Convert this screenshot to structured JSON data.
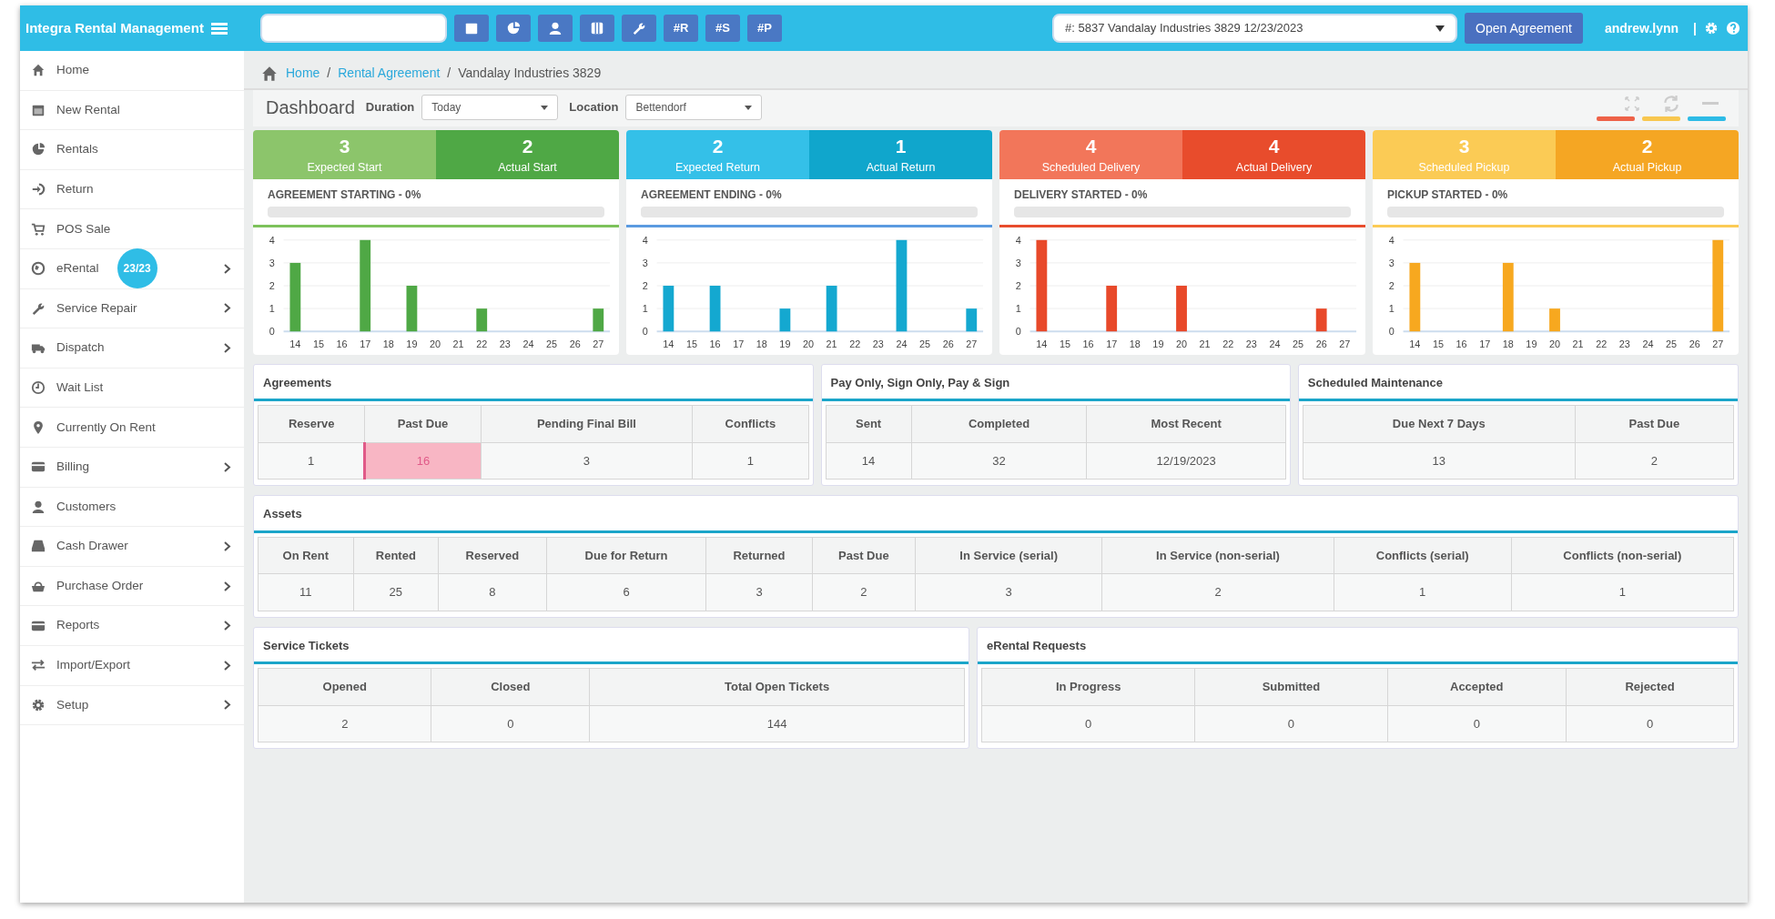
{
  "topbar": {
    "brand": "Integra Rental Management",
    "toolbar": [
      {
        "kind": "icon"
      },
      {
        "kind": "icon"
      },
      {
        "kind": "icon"
      },
      {
        "kind": "icon"
      },
      {
        "kind": "icon"
      },
      {
        "kind": "text",
        "label": "#R"
      },
      {
        "kind": "text",
        "label": "#S"
      },
      {
        "kind": "text",
        "label": "#P"
      }
    ],
    "agreement_select": {
      "value": "#: 5837 Vandalay Industries 3829 12/23/2023"
    },
    "open_button": "Open Agreement",
    "user": "andrew.lynn",
    "separator": "|"
  },
  "sidebar": {
    "items": [
      {
        "label": "Home",
        "submenu": false
      },
      {
        "label": "New Rental",
        "submenu": false
      },
      {
        "label": "Rentals",
        "submenu": false
      },
      {
        "label": "Return",
        "submenu": false
      },
      {
        "label": "POS Sale",
        "submenu": false
      },
      {
        "label": "eRental",
        "submenu": true,
        "badge": "23/23"
      },
      {
        "label": "Service Repair",
        "submenu": true
      },
      {
        "label": "Dispatch",
        "submenu": true
      },
      {
        "label": "Wait List",
        "submenu": false
      },
      {
        "label": "Currently On Rent",
        "submenu": false
      },
      {
        "label": "Billing",
        "submenu": true
      },
      {
        "label": "Customers",
        "submenu": false
      },
      {
        "label": "Cash Drawer",
        "submenu": true
      },
      {
        "label": "Purchase Order",
        "submenu": true
      },
      {
        "label": "Reports",
        "submenu": true
      },
      {
        "label": "Import/Export",
        "submenu": true
      },
      {
        "label": "Setup",
        "submenu": true
      }
    ]
  },
  "breadcrumb": {
    "separator": "/",
    "items": [
      {
        "label": "Home",
        "link": true
      },
      {
        "label": "Rental Agreement",
        "link": true
      },
      {
        "label": "Vandalay Industries 3829",
        "link": false
      }
    ]
  },
  "dashboard": {
    "title": "Dashboard",
    "filters": [
      {
        "label": "Duration",
        "value": "Today"
      },
      {
        "label": "Location",
        "value": "Bettendorf"
      }
    ],
    "theme_swatches": [
      {
        "color": "#ee6248"
      },
      {
        "color": "#f8c74f"
      },
      {
        "color": "#2dbbe6"
      }
    ]
  },
  "stat_cards": [
    {
      "stats": [
        {
          "value": "3",
          "label": "Expected Start",
          "color": "#8cc56b"
        },
        {
          "value": "2",
          "label": "Actual Start",
          "color": "#4fa845"
        }
      ],
      "progress_label": "AGREEMENT STARTING - 0%",
      "level": 0,
      "color": "#7dc25b",
      "chart_data": {
        "type": "bar",
        "categories": [
          "14",
          "15",
          "16",
          "17",
          "18",
          "19",
          "20",
          "21",
          "22",
          "23",
          "24",
          "25",
          "26",
          "27"
        ],
        "grid": true,
        "series": [
          {
            "color": "#4fa845",
            "values": [
              3,
              0,
              0,
              4,
              0,
              2,
              0,
              0,
              1,
              0,
              0,
              0,
              0,
              1
            ]
          }
        ],
        "ylim": [
          0,
          4
        ],
        "yticks": [
          0,
          1,
          2,
          3,
          4
        ]
      }
    },
    {
      "stats": [
        {
          "value": "2",
          "label": "Expected Return",
          "color": "#34c0e8"
        },
        {
          "value": "1",
          "label": "Actual Return",
          "color": "#10a6cc"
        }
      ],
      "progress_label": "AGREEMENT ENDING - 0%",
      "level": 0,
      "color": "#5b9be0",
      "chart_data": {
        "type": "bar",
        "categories": [
          "14",
          "15",
          "16",
          "17",
          "18",
          "19",
          "20",
          "21",
          "22",
          "23",
          "24",
          "25",
          "26",
          "27"
        ],
        "grid": true,
        "series": [
          {
            "color": "#14a8d0",
            "values": [
              2,
              0,
              2,
              0,
              0,
              1,
              0,
              2,
              0,
              0,
              4,
              0,
              0,
              1
            ]
          }
        ],
        "ylim": [
          0,
          4
        ],
        "yticks": [
          0,
          1,
          2,
          3,
          4
        ]
      }
    },
    {
      "stats": [
        {
          "value": "4",
          "label": "Scheduled Delivery",
          "color": "#f2765a"
        },
        {
          "value": "4",
          "label": "Actual Delivery",
          "color": "#e84c2c"
        }
      ],
      "progress_label": "DELIVERY STARTED - 0%",
      "level": 0,
      "color": "#e84c2c",
      "chart_data": {
        "type": "bar",
        "categories": [
          "14",
          "15",
          "16",
          "17",
          "18",
          "19",
          "20",
          "21",
          "22",
          "23",
          "24",
          "25",
          "26",
          "27"
        ],
        "grid": true,
        "series": [
          {
            "color": "#e8492a",
            "values": [
              4,
              0,
              0,
              2,
              0,
              0,
              2,
              0,
              0,
              0,
              0,
              0,
              1,
              0
            ]
          }
        ],
        "ylim": [
          0,
          4
        ],
        "yticks": [
          0,
          1,
          2,
          3,
          4
        ]
      }
    },
    {
      "stats": [
        {
          "value": "3",
          "label": "Scheduled Pickup",
          "color": "#fbcb55"
        },
        {
          "value": "2",
          "label": "Actual Pickup",
          "color": "#f5a623"
        }
      ],
      "progress_label": "PICKUP STARTED - 0%",
      "level": 0,
      "color": "#fbcb55",
      "chart_data": {
        "type": "bar",
        "categories": [
          "14",
          "15",
          "16",
          "17",
          "18",
          "19",
          "20",
          "21",
          "22",
          "23",
          "24",
          "25",
          "26",
          "27"
        ],
        "grid": true,
        "series": [
          {
            "color": "#f7a81f",
            "values": [
              3,
              0,
              0,
              0,
              3,
              0,
              1,
              0,
              0,
              0,
              0,
              0,
              0,
              4
            ]
          }
        ],
        "ylim": [
          0,
          4
        ],
        "yticks": [
          0,
          1,
          2,
          3,
          4
        ]
      }
    }
  ],
  "panels": [
    [
      {
        "title": "Agreements",
        "columns": [
          {
            "header": "Reserve",
            "value": "1",
            "alert": false
          },
          {
            "header": "Past Due",
            "value": "16",
            "alert": true
          },
          {
            "header": "Pending Final Bill",
            "value": "3",
            "alert": false
          },
          {
            "header": "Conflicts",
            "value": "1",
            "alert": false
          }
        ]
      },
      {
        "title": "Pay Only, Sign Only, Pay & Sign",
        "columns": [
          {
            "header": "Sent",
            "value": "14"
          },
          {
            "header": "Completed",
            "value": "32"
          },
          {
            "header": "Most Recent",
            "value": "12/19/2023"
          }
        ]
      },
      {
        "title": "Scheduled Maintenance",
        "columns": [
          {
            "header": "Due Next 7 Days",
            "value": "13"
          },
          {
            "header": "Past Due",
            "value": "2"
          }
        ]
      }
    ],
    [
      {
        "title": "Assets",
        "columns": [
          {
            "header": "On Rent",
            "value": "11"
          },
          {
            "header": "Rented",
            "value": "25"
          },
          {
            "header": "Reserved",
            "value": "8"
          },
          {
            "header": "Due for Return",
            "value": "6"
          },
          {
            "header": "Returned",
            "value": "3"
          },
          {
            "header": "Past Due",
            "value": "2"
          },
          {
            "header": "In Service (serial)",
            "value": "3"
          },
          {
            "header": "In Service (non-serial)",
            "value": "2"
          },
          {
            "header": "Conflicts (serial)",
            "value": "1"
          },
          {
            "header": "Conflicts (non-serial)",
            "value": "1"
          }
        ]
      }
    ],
    [
      {
        "title": "Service Tickets",
        "columns": [
          {
            "header": "Opened",
            "value": "2"
          },
          {
            "header": "Closed",
            "value": "0"
          },
          {
            "header": "Total Open Tickets",
            "value": "144"
          }
        ]
      },
      {
        "title": "eRental Requests",
        "columns": [
          {
            "header": "In Progress",
            "value": "0"
          },
          {
            "header": "Submitted",
            "value": "0"
          },
          {
            "header": "Accepted",
            "value": "0"
          },
          {
            "header": "Rejected",
            "value": "0"
          }
        ]
      }
    ]
  ]
}
